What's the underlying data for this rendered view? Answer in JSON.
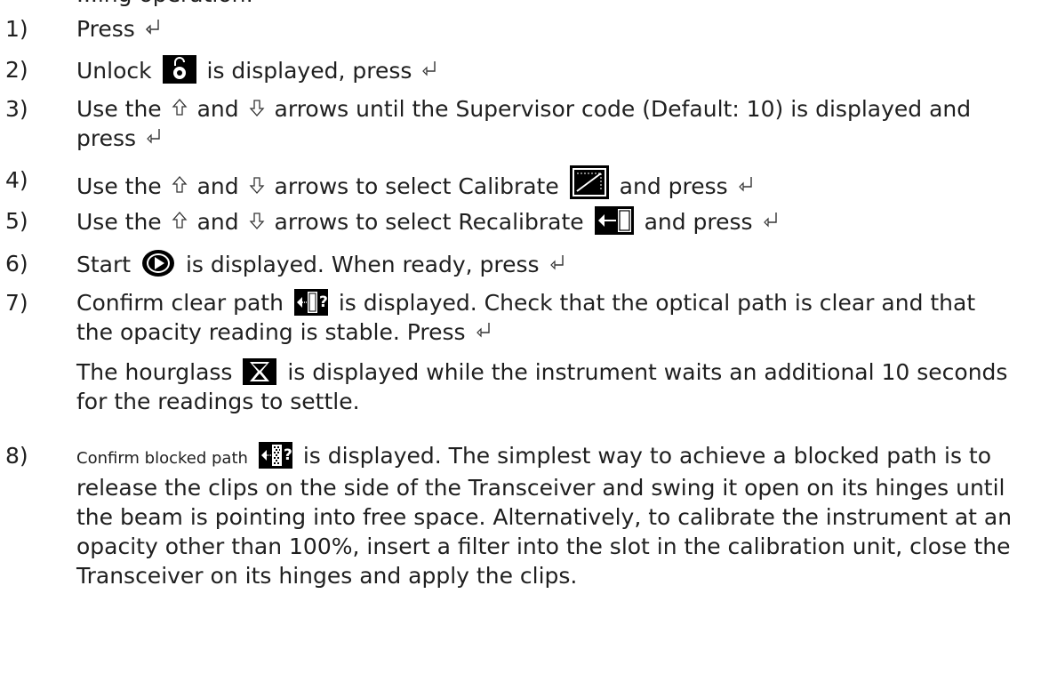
{
  "header_fragment": "...ing operation:",
  "steps": [
    {
      "num": "1)",
      "t1": "Press"
    },
    {
      "num": "2)",
      "t1": "Unlock",
      "t2": "is displayed, press"
    },
    {
      "num": "3)",
      "t1": "Use the",
      "t2": "and",
      "t3": "arrows until the Supervisor code (Default: 10) is displayed and press"
    },
    {
      "num": "4)",
      "t1": "Use the",
      "t2": "and",
      "t3": "arrows to select Calibrate",
      "t4": "and press"
    },
    {
      "num": "5)",
      "t1": "Use the",
      "t2": "and",
      "t3": "arrows to select Recalibrate",
      "t4": "and press"
    },
    {
      "num": "6)",
      "t1": "Start",
      "t2": "is displayed. When ready, press"
    },
    {
      "num": "7)",
      "t1": "Confirm clear path",
      "t2": "is displayed. Check that the optical path is clear and that the opacity reading is stable. Press",
      "p2a": "The hourglass",
      "p2b": "is displayed while the instrument waits an additional 10 seconds for the readings to settle."
    },
    {
      "num": "8)",
      "t1": "Confirm blocked path",
      "t2": "is displayed. The simplest way to achieve a blocked path is to release the clips on the side of the Transceiver and swing it open on its hinges until the beam is pointing into free space. Alternatively, to calibrate the instrument at an opacity other than 100%, insert a filter into the slot in the calibration unit, close the Transceiver on its hinges and apply the clips."
    }
  ],
  "icons": {
    "enter": "enter-key-icon",
    "up": "up-arrow-icon",
    "down": "down-arrow-icon",
    "unlock": "unlock-icon",
    "calibrate": "calibrate-icon",
    "recalibrate": "recalibrate-icon",
    "start": "start-icon",
    "clear_path": "confirm-clear-path-icon",
    "hourglass": "hourglass-icon",
    "blocked_path": "confirm-blocked-path-icon"
  }
}
